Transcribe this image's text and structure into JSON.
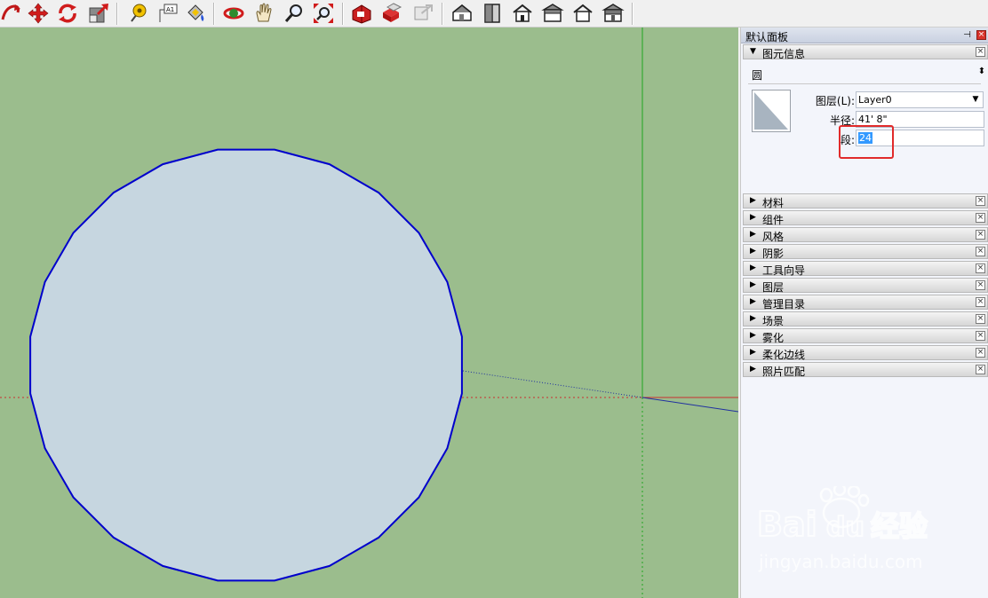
{
  "toolbar": {
    "groups": [
      [
        "lasso-arrow-icon",
        "move-icon",
        "rotate-icon",
        "scale-icon"
      ],
      [
        "tape-measure-icon",
        "text-label-icon",
        "paint-bucket-icon"
      ],
      [
        "orbit-icon",
        "pan-icon",
        "zoom-icon",
        "zoom-extents-icon"
      ],
      [
        "warehouse-icon",
        "components-3d-icon",
        "share-model-icon"
      ],
      [
        "iso-view-icon",
        "top-view-icon",
        "front-view-icon",
        "right-view-icon",
        "back-view-icon",
        "left-view-icon"
      ]
    ]
  },
  "viewport": {
    "background": "#9bbd8d",
    "circle_fill": "#c6d6e0",
    "circle_edge_color": "#0000cc",
    "circle_segments": 24
  },
  "panel": {
    "title": "默认面板",
    "entity_info": {
      "header": "图元信息",
      "type": "圆",
      "layer_label": "图层(L):",
      "layer_value": "Layer0",
      "radius_label": "半径:",
      "radius_value": "41' 8\"",
      "segments_label": "段:",
      "segments_value": "24"
    },
    "trays": [
      "材料",
      "组件",
      "风格",
      "阴影",
      "工具向导",
      "图层",
      "管理目录",
      "场景",
      "雾化",
      "柔化边线",
      "照片匹配"
    ]
  },
  "watermark": {
    "brand": "Bai",
    "brand2": "du",
    "suffix": "经验",
    "url": "jingyan.baidu.com"
  }
}
